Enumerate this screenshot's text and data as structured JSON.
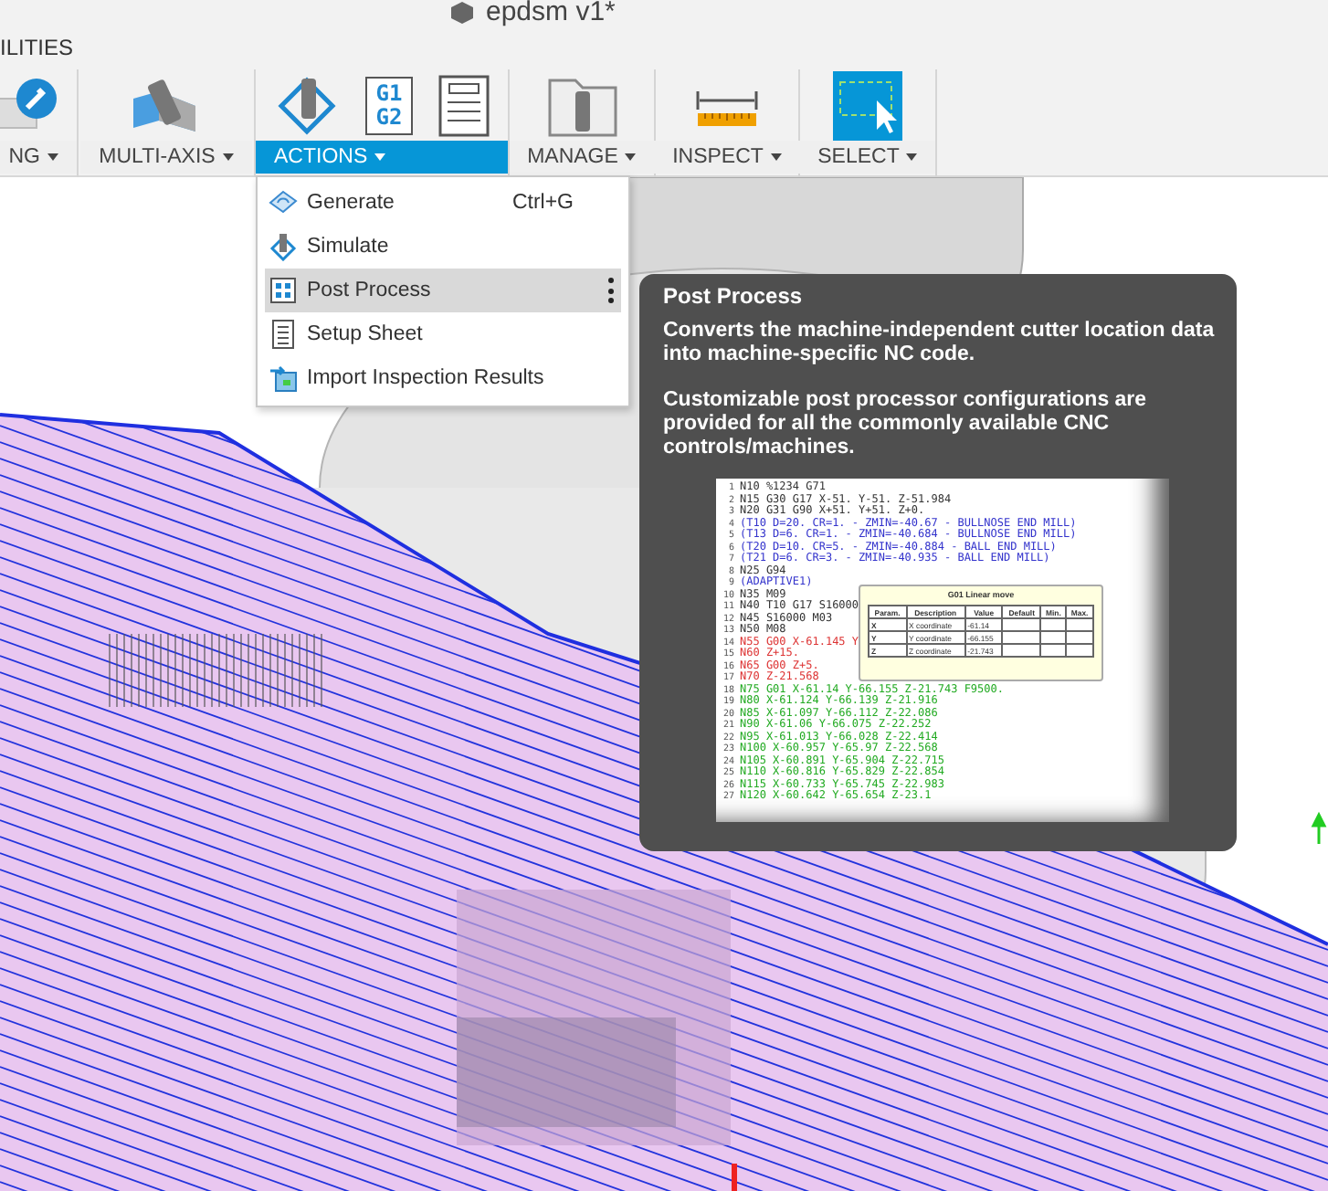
{
  "document_title": "epdsm v1*",
  "workspace_tab": "ILITIES",
  "toolbar_groups": [
    {
      "label": "NG",
      "kind": "utilities",
      "selected": false,
      "icons": [
        {
          "kind": "wrench"
        }
      ]
    },
    {
      "label": "MULTI-AXIS",
      "kind": "multiaxis",
      "selected": false,
      "icons": [
        {
          "kind": "multiaxis"
        }
      ]
    },
    {
      "label": "ACTIONS",
      "kind": "actions",
      "selected": true,
      "icons": [
        {
          "kind": "simulate"
        },
        {
          "kind": "post",
          "text": "G1 G2"
        },
        {
          "kind": "sheet"
        }
      ]
    },
    {
      "label": "MANAGE",
      "kind": "manage",
      "selected": false,
      "icons": [
        {
          "kind": "folder"
        }
      ]
    },
    {
      "label": "INSPECT",
      "kind": "inspect",
      "selected": false,
      "icons": [
        {
          "kind": "ruler"
        }
      ]
    },
    {
      "label": "SELECT",
      "kind": "select",
      "selected": false,
      "icons": [
        {
          "kind": "select"
        }
      ]
    }
  ],
  "menu": {
    "items": [
      {
        "label": "Generate",
        "shortcut": "Ctrl+G",
        "kind": "generate",
        "selected": false,
        "has_options": false
      },
      {
        "label": "Simulate",
        "kind": "simulate",
        "selected": false,
        "has_options": false
      },
      {
        "label": "Post Process",
        "kind": "post",
        "selected": true,
        "has_options": true
      },
      {
        "label": "Setup Sheet",
        "kind": "sheet",
        "selected": false,
        "has_options": false
      },
      {
        "label": "Import Inspection Results",
        "kind": "import",
        "selected": false,
        "has_options": false
      }
    ]
  },
  "tooltip": {
    "title": "Post Process",
    "paragraphs": [
      "Converts the machine-independent cutter location data into machine-specific NC code.",
      "Customizable post processor configurations are provided for all the commonly available CNC controls/machines."
    ],
    "preview": {
      "lines": [
        {
          "number": "1",
          "text": "N10 %1234 G71",
          "color": "#333333"
        },
        {
          "number": "2",
          "text": "N15 G30 G17 X-51. Y-51. Z-51.984",
          "color": "#333333"
        },
        {
          "number": "3",
          "text": "N20 G31 G90 X+51. Y+51. Z+0.",
          "color": "#333333"
        },
        {
          "number": "4",
          "text": "(T10 D=20. CR=1. - ZMIN=-40.67 - BULLNOSE END MILL)",
          "color": "#3333cc"
        },
        {
          "number": "5",
          "text": "(T13 D=6. CR=1. - ZMIN=-40.684 - BULLNOSE END MILL)",
          "color": "#3333cc"
        },
        {
          "number": "6",
          "text": "(T20 D=10. CR=5. - ZMIN=-40.884 - BALL END MILL)",
          "color": "#3333cc"
        },
        {
          "number": "7",
          "text": "(T21 D=6. CR=3. - ZMIN=-40.935 - BALL END MILL)",
          "color": "#3333cc"
        },
        {
          "number": "8",
          "text": "N25 G94",
          "color": "#333333"
        },
        {
          "number": "9",
          "text": "(ADAPTIVE1)",
          "color": "#3333cc"
        },
        {
          "number": "10",
          "text": "N35 M09",
          "color": "#333333"
        },
        {
          "number": "11",
          "text": "N40 T10 G17 S16000",
          "color": "#333333"
        },
        {
          "number": "12",
          "text": "N45 S16000 M03",
          "color": "#333333"
        },
        {
          "number": "13",
          "text": "N50 M08",
          "color": "#333333"
        },
        {
          "number": "14",
          "text": "N55 G00 X-61.145 Y",
          "color": "#dd3333"
        },
        {
          "number": "15",
          "text": "N60 Z+15.",
          "color": "#dd3333"
        },
        {
          "number": "16",
          "text": "N65 G00 Z+5.",
          "color": "#dd3333"
        },
        {
          "number": "17",
          "text": "N70 Z-21.568",
          "color": "#dd3333"
        },
        {
          "number": "18",
          "text": "N75 G01 X-61.14 Y-66.155 Z-21.743 F9500.",
          "color": "#22aa22"
        },
        {
          "number": "19",
          "text": "N80 X-61.124 Y-66.139 Z-21.916",
          "color": "#22aa22"
        },
        {
          "number": "20",
          "text": "N85 X-61.097 Y-66.112 Z-22.086",
          "color": "#22aa22"
        },
        {
          "number": "21",
          "text": "N90 X-61.06 Y-66.075 Z-22.252",
          "color": "#22aa22"
        },
        {
          "number": "22",
          "text": "N95 X-61.013 Y-66.028 Z-22.414",
          "color": "#22aa22"
        },
        {
          "number": "23",
          "text": "N100 X-60.957 Y-65.97 Z-22.568",
          "color": "#22aa22"
        },
        {
          "number": "24",
          "text": "N105 X-60.891 Y-65.904 Z-22.715",
          "color": "#22aa22"
        },
        {
          "number": "25",
          "text": "N110 X-60.816 Y-65.829 Z-22.854",
          "color": "#22aa22"
        },
        {
          "number": "26",
          "text": "N115 X-60.733 Y-65.745 Z-22.983",
          "color": "#22aa22"
        },
        {
          "number": "27",
          "text": "N120 X-60.642 Y-65.654 Z-23.1",
          "color": "#22aa22"
        }
      ],
      "callout": {
        "title": "G01 Linear move",
        "columns": [
          "Param.",
          "Description",
          "Value",
          "Default",
          "Min.",
          "Max."
        ],
        "rows": [
          [
            "X",
            "X coordinate",
            "-61.14"
          ],
          [
            "Y",
            "Y coordinate",
            "-66.155"
          ],
          [
            "Z",
            "Z coordinate",
            "-21.743"
          ]
        ]
      }
    }
  }
}
